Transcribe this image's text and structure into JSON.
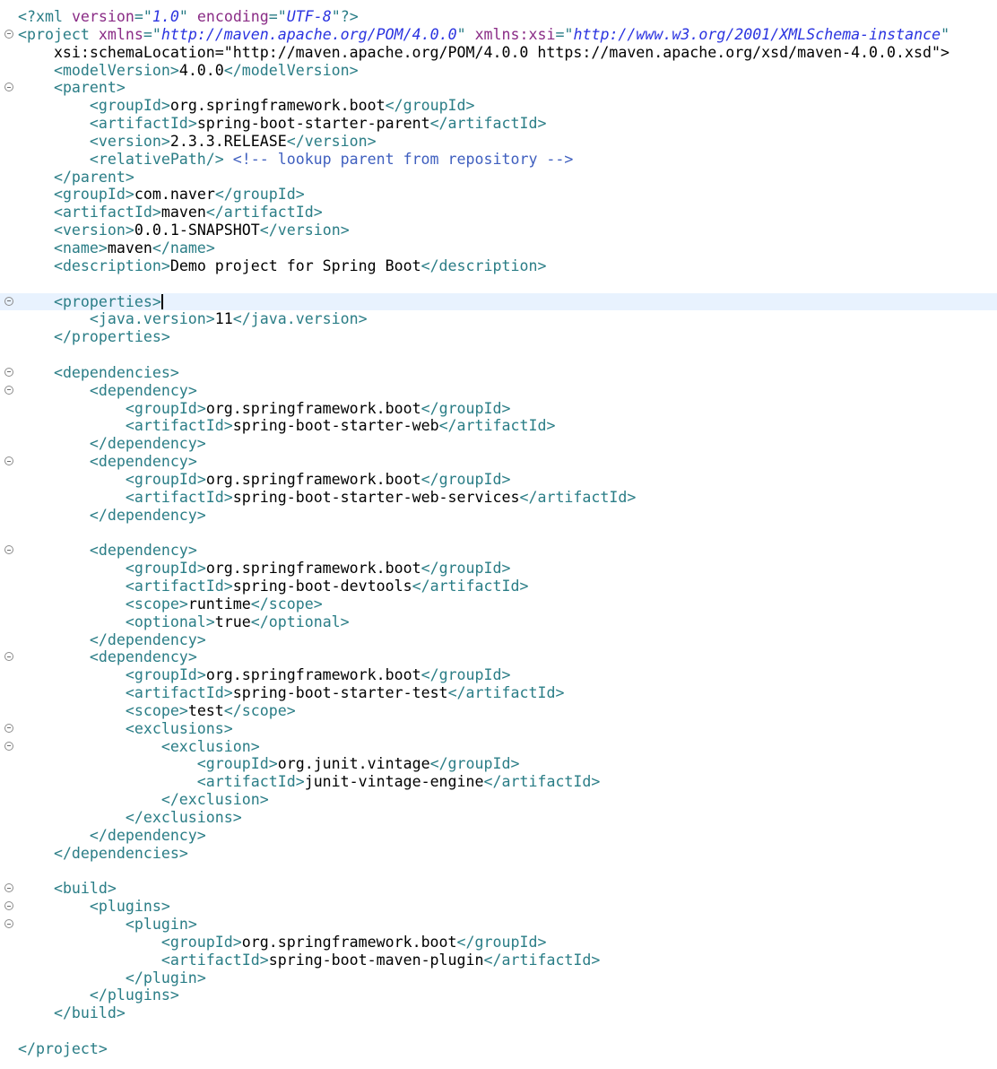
{
  "editor": {
    "file_type": "xml",
    "current_line": 17,
    "lines": [
      {
        "fold": false,
        "text": "  <?xml version=\"1.0\" encoding=\"UTF-8\"?>"
      },
      {
        "fold": true,
        "text": "  <project xmlns=\"http://maven.apache.org/POM/4.0.0\" xmlns:xsi=\"http://www.w3.org/2001/XMLSchema-instance\""
      },
      {
        "fold": false,
        "text": "      xsi:schemaLocation=\"http://maven.apache.org/POM/4.0.0 https://maven.apache.org/xsd/maven-4.0.0.xsd\">"
      },
      {
        "fold": false,
        "text": "      <modelVersion>4.0.0</modelVersion>"
      },
      {
        "fold": true,
        "text": "      <parent>"
      },
      {
        "fold": false,
        "text": "          <groupId>org.springframework.boot</groupId>"
      },
      {
        "fold": false,
        "text": "          <artifactId>spring-boot-starter-parent</artifactId>"
      },
      {
        "fold": false,
        "text": "          <version>2.3.3.RELEASE</version>"
      },
      {
        "fold": false,
        "text": "          <relativePath/> <!-- lookup parent from repository -->"
      },
      {
        "fold": false,
        "text": "      </parent>"
      },
      {
        "fold": false,
        "text": "      <groupId>com.naver</groupId>"
      },
      {
        "fold": false,
        "text": "      <artifactId>maven</artifactId>"
      },
      {
        "fold": false,
        "text": "      <version>0.0.1-SNAPSHOT</version>"
      },
      {
        "fold": false,
        "text": "      <name>maven</name>"
      },
      {
        "fold": false,
        "text": "      <description>Demo project for Spring Boot</description>"
      },
      {
        "fold": false,
        "text": ""
      },
      {
        "fold": true,
        "text": "      <properties>"
      },
      {
        "fold": false,
        "text": "          <java.version>11</java.version>"
      },
      {
        "fold": false,
        "text": "      </properties>"
      },
      {
        "fold": false,
        "text": ""
      },
      {
        "fold": true,
        "text": "      <dependencies>"
      },
      {
        "fold": true,
        "text": "          <dependency>"
      },
      {
        "fold": false,
        "text": "              <groupId>org.springframework.boot</groupId>"
      },
      {
        "fold": false,
        "text": "              <artifactId>spring-boot-starter-web</artifactId>"
      },
      {
        "fold": false,
        "text": "          </dependency>"
      },
      {
        "fold": true,
        "text": "          <dependency>"
      },
      {
        "fold": false,
        "text": "              <groupId>org.springframework.boot</groupId>"
      },
      {
        "fold": false,
        "text": "              <artifactId>spring-boot-starter-web-services</artifactId>"
      },
      {
        "fold": false,
        "text": "          </dependency>"
      },
      {
        "fold": false,
        "text": ""
      },
      {
        "fold": true,
        "text": "          <dependency>"
      },
      {
        "fold": false,
        "text": "              <groupId>org.springframework.boot</groupId>"
      },
      {
        "fold": false,
        "text": "              <artifactId>spring-boot-devtools</artifactId>"
      },
      {
        "fold": false,
        "text": "              <scope>runtime</scope>"
      },
      {
        "fold": false,
        "text": "              <optional>true</optional>"
      },
      {
        "fold": false,
        "text": "          </dependency>"
      },
      {
        "fold": true,
        "text": "          <dependency>"
      },
      {
        "fold": false,
        "text": "              <groupId>org.springframework.boot</groupId>"
      },
      {
        "fold": false,
        "text": "              <artifactId>spring-boot-starter-test</artifactId>"
      },
      {
        "fold": false,
        "text": "              <scope>test</scope>"
      },
      {
        "fold": true,
        "text": "              <exclusions>"
      },
      {
        "fold": true,
        "text": "                  <exclusion>"
      },
      {
        "fold": false,
        "text": "                      <groupId>org.junit.vintage</groupId>"
      },
      {
        "fold": false,
        "text": "                      <artifactId>junit-vintage-engine</artifactId>"
      },
      {
        "fold": false,
        "text": "                  </exclusion>"
      },
      {
        "fold": false,
        "text": "              </exclusions>"
      },
      {
        "fold": false,
        "text": "          </dependency>"
      },
      {
        "fold": false,
        "text": "      </dependencies>"
      },
      {
        "fold": false,
        "text": ""
      },
      {
        "fold": true,
        "text": "      <build>"
      },
      {
        "fold": true,
        "text": "          <plugins>"
      },
      {
        "fold": true,
        "text": "              <plugin>"
      },
      {
        "fold": false,
        "text": "                  <groupId>org.springframework.boot</groupId>"
      },
      {
        "fold": false,
        "text": "                  <artifactId>spring-boot-maven-plugin</artifactId>"
      },
      {
        "fold": false,
        "text": "              </plugin>"
      },
      {
        "fold": false,
        "text": "          </plugins>"
      },
      {
        "fold": false,
        "text": "      </build>"
      },
      {
        "fold": false,
        "text": ""
      },
      {
        "fold": false,
        "text": "  </project>"
      }
    ]
  }
}
